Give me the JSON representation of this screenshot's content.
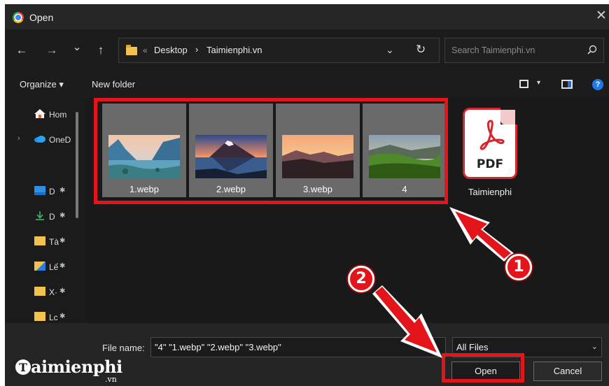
{
  "window": {
    "title": "Open",
    "close_glyph": "✕"
  },
  "nav": {
    "back_glyph": "←",
    "forward_glyph": "→",
    "recent_glyph": "⌄",
    "up_glyph": "↑",
    "address": {
      "overflow": "«",
      "segments": [
        "Desktop",
        "Taimienphi.vn"
      ],
      "separator": "›",
      "dropdown_glyph": "⌄",
      "refresh_glyph": "↻"
    },
    "search_placeholder": "Search Taimienphi.vn"
  },
  "toolbar": {
    "organize_label": "Organize ▾",
    "new_folder_label": "New folder",
    "view_dropdown_glyph": "▾",
    "help_glyph": "?"
  },
  "sidebar": {
    "items": [
      {
        "label": "Hom",
        "icon": "home-icon",
        "pinned": false
      },
      {
        "label": "OneD",
        "icon": "onedrive-icon",
        "pinned": false
      },
      {
        "label": "D",
        "icon": "desktop-icon",
        "pinned": true
      },
      {
        "label": "D",
        "icon": "download-icon",
        "pinned": true
      },
      {
        "label": "Tà",
        "icon": "folder-icon",
        "pinned": true
      },
      {
        "label": "Lế",
        "icon": "library-folder-icon",
        "pinned": true
      },
      {
        "label": "X·",
        "icon": "folder-icon",
        "pinned": true
      },
      {
        "label": "Lc",
        "icon": "folder-icon",
        "pinned": true
      }
    ],
    "pin_glyph": "✱",
    "expand_glyph": "›"
  },
  "files": [
    {
      "name": "1.webp",
      "thumb": "lake-mountains"
    },
    {
      "name": "2.webp",
      "thumb": "volcano-reflection"
    },
    {
      "name": "3.webp",
      "thumb": "sunset-mountains"
    },
    {
      "name": "4",
      "thumb": "green-hills"
    },
    {
      "name": "Taimienphi",
      "type": "pdf",
      "icon_text": "PDF"
    }
  ],
  "bottom": {
    "file_name_label": "File name:",
    "file_name_value": "\"4\" \"1.webp\" \"2.webp\" \"3.webp\"",
    "file_type_value": "All Files",
    "file_type_chevron": "⌄",
    "open_label": "Open",
    "cancel_label": "Cancel"
  },
  "annotations": {
    "badge1": "1",
    "badge2": "2",
    "accent": "#e3141a"
  },
  "watermark": {
    "text": "aimienphi",
    "suffix": ".vn"
  }
}
